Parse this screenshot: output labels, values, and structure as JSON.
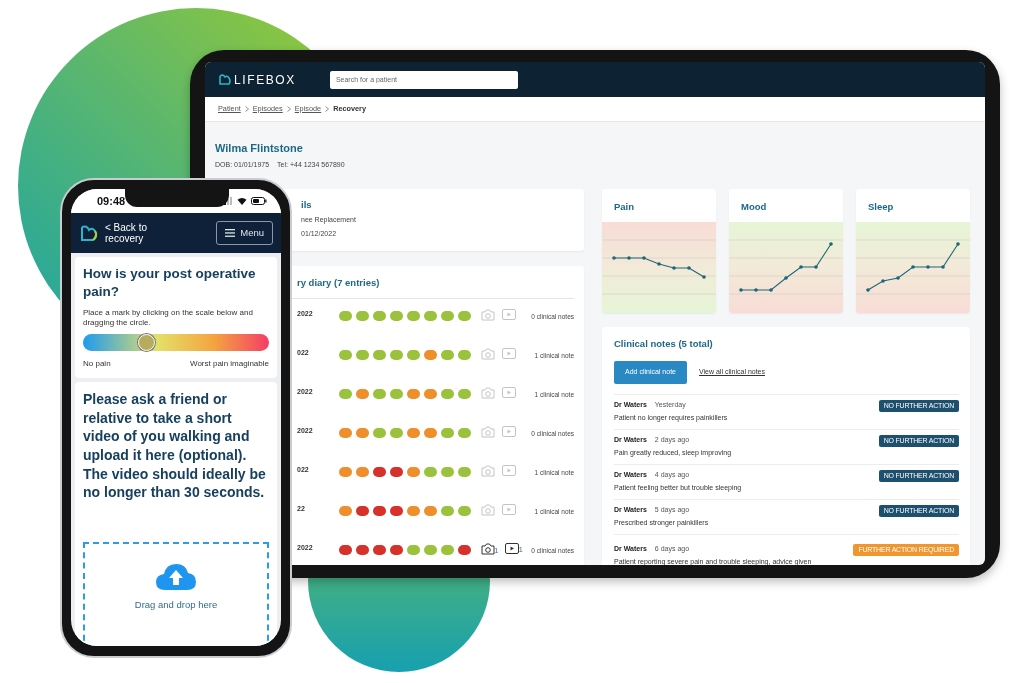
{
  "tablet": {
    "logo": "LIFEBOX",
    "search": {
      "placeholder": "Search for a patient"
    },
    "breadcrumbs": [
      {
        "label": "Patient",
        "selected": false
      },
      {
        "label": "Episodes",
        "selected": false
      },
      {
        "label": "Episode",
        "selected": false
      },
      {
        "label": "Recovery",
        "selected": true
      }
    ],
    "patient": {
      "name": "Wilma Flintstone",
      "dob": "DOB: 01/01/1975",
      "tel": "Tel: +44 1234 567890"
    },
    "details": {
      "title": "ils",
      "lines": [
        "nee Replacement",
        "01/12/2022"
      ]
    },
    "diary": {
      "title": "ry diary (7 entries)",
      "rows": [
        {
          "date": "2022",
          "dots": [
            {
              "color": "#9bc23c"
            },
            {
              "color": "#9bc23c"
            },
            {
              "color": "#9bc23c"
            },
            {
              "color": "#9bc23c"
            },
            {
              "color": "#9bc23c"
            },
            {
              "color": "#9bc23c"
            },
            {
              "color": "#9bc23c"
            },
            {
              "color": "#9bc23c"
            }
          ],
          "media": false,
          "notes": "0 clinical notes"
        },
        {
          "date": "022",
          "dots": [
            {
              "color": "#9bc23c"
            },
            {
              "color": "#9bc23c"
            },
            {
              "color": "#9bc23c"
            },
            {
              "color": "#9bc23c"
            },
            {
              "color": "#9bc23c"
            },
            {
              "color": "#ef8f2c"
            },
            {
              "color": "#9bc23c"
            },
            {
              "color": "#9bc23c"
            }
          ],
          "media": false,
          "notes": "1 clinical note"
        },
        {
          "date": "2022",
          "dots": [
            {
              "color": "#9bc23c"
            },
            {
              "color": "#ef8f2c"
            },
            {
              "color": "#9bc23c"
            },
            {
              "color": "#9bc23c"
            },
            {
              "color": "#ef8f2c"
            },
            {
              "color": "#ef8f2c"
            },
            {
              "color": "#9bc23c"
            },
            {
              "color": "#9bc23c"
            }
          ],
          "media": false,
          "notes": "1 clinical note"
        },
        {
          "date": "2022",
          "dots": [
            {
              "color": "#ef8f2c"
            },
            {
              "color": "#ef8f2c"
            },
            {
              "color": "#9bc23c"
            },
            {
              "color": "#9bc23c"
            },
            {
              "color": "#ef8f2c"
            },
            {
              "color": "#ef8f2c"
            },
            {
              "color": "#9bc23c"
            },
            {
              "color": "#9bc23c"
            }
          ],
          "media": false,
          "notes": "0 clinical notes"
        },
        {
          "date": "022",
          "dots": [
            {
              "color": "#ef8f2c"
            },
            {
              "color": "#ef8f2c"
            },
            {
              "color": "#d6312a"
            },
            {
              "color": "#d6312a"
            },
            {
              "color": "#ef8f2c"
            },
            {
              "color": "#9bc23c"
            },
            {
              "color": "#9bc23c"
            },
            {
              "color": "#9bc23c"
            }
          ],
          "media": false,
          "notes": "1 clinical note"
        },
        {
          "date": "22",
          "dots": [
            {
              "color": "#ef8f2c"
            },
            {
              "color": "#d6312a"
            },
            {
              "color": "#d6312a"
            },
            {
              "color": "#d6312a"
            },
            {
              "color": "#ef8f2c"
            },
            {
              "color": "#ef8f2c"
            },
            {
              "color": "#9bc23c"
            },
            {
              "color": "#9bc23c"
            }
          ],
          "media": false,
          "notes": "1 clinical note"
        },
        {
          "date": "2022",
          "dots": [
            {
              "color": "#d6312a"
            },
            {
              "color": "#d6312a"
            },
            {
              "color": "#d6312a"
            },
            {
              "color": "#d6312a"
            },
            {
              "color": "#9bc23c"
            },
            {
              "color": "#9bc23c"
            },
            {
              "color": "#9bc23c"
            },
            {
              "color": "#d6312a"
            }
          ],
          "media": true,
          "photo_count": "1",
          "video_count": "1",
          "notes": "0 clinical notes"
        }
      ]
    },
    "charts": [
      {
        "title": "Pain"
      },
      {
        "title": "Mood"
      },
      {
        "title": "Sleep"
      }
    ],
    "clinical_notes": {
      "title": "Clinical notes (5 total)",
      "add_button": "Add clinical note",
      "view_all": "View all clinical notes",
      "notes": [
        {
          "author": "Dr Waters",
          "time": "Yesterday",
          "text": "Patient no longer requires painkillers",
          "status": {
            "label": "NO FURTHER ACTION",
            "kind": "no_action"
          }
        },
        {
          "author": "Dr Waters",
          "time": "2 days ago",
          "text": "Pain greatly reduced, sleep improving",
          "status": {
            "label": "NO FURTHER ACTION",
            "kind": "no_action"
          }
        },
        {
          "author": "Dr Waters",
          "time": "4 days ago",
          "text": "Patient feeling better but trouble sleeping",
          "status": {
            "label": "NO FURTHER ACTION",
            "kind": "no_action"
          }
        },
        {
          "author": "Dr Waters",
          "time": "5 days ago",
          "text": "Prescribed stronger painkillers",
          "status": {
            "label": "NO FURTHER ACTION",
            "kind": "no_action"
          }
        },
        {
          "author": "Dr Waters",
          "time": "6 days ago",
          "text": "Patient reporting severe pain and trouble sleeping, advice given",
          "status": {
            "label": "FURTHER ACTION REQUIRED",
            "kind": "action_required"
          }
        }
      ]
    }
  },
  "phone": {
    "time": "09:48",
    "back_link": "< Back to recovery",
    "menu_button": "Menu",
    "pain_question": {
      "title": "How is your post operative pain?",
      "instructions": "Place a mark by clicking on the scale below and dragging the circle.",
      "level": 0.34,
      "min_label": "No pain",
      "max_label": "Worst pain imaginable"
    },
    "video_request": {
      "text": "Please ask a friend or relative to take a short video of you walking and upload it here (optional). The video should ideally be no longer than 30 seconds.",
      "dropzone": "Drag and drop here"
    }
  }
}
